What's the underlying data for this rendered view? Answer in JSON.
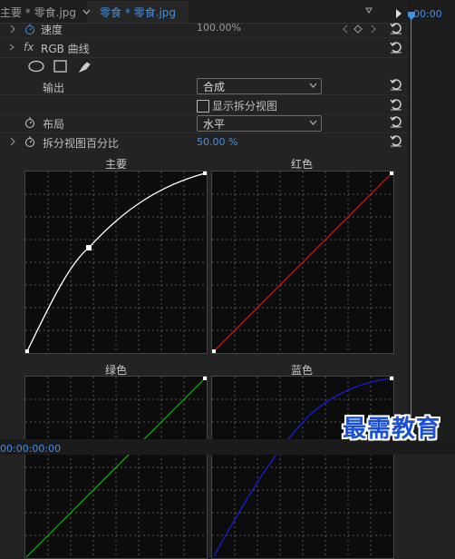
{
  "tabs": {
    "tab1_label": "主要 * 零食.jpg",
    "tab2_label": "零食 * 零食.jpg"
  },
  "timecode_top": "00:00",
  "timecode_bottom": "00:00:00:00",
  "speed": {
    "label": "速度",
    "value": "100.00%"
  },
  "effect": {
    "fx": "fx",
    "name": "RGB 曲线"
  },
  "output": {
    "label": "输出",
    "value": "合成"
  },
  "split_view": {
    "label": "显示拆分视图",
    "checked": false
  },
  "layout": {
    "label": "布局",
    "value": "水平"
  },
  "split_percent": {
    "label": "拆分视图百分比",
    "value": "50.00 %"
  },
  "curves": {
    "master_title": "主要",
    "red_title": "红色",
    "green_title": "绿色",
    "blue_title": "蓝色",
    "colors": {
      "master": "#ffffff",
      "red": "#c41818",
      "green": "#1aa81a",
      "blue": "#1a1ad8"
    }
  },
  "watermark": "最需教育"
}
